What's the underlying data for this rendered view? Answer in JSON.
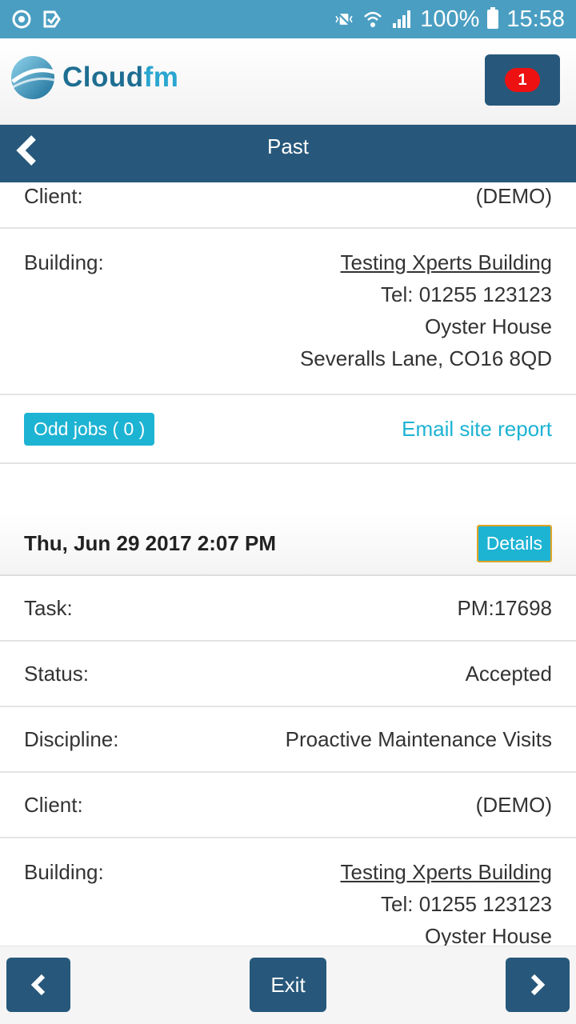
{
  "status_bar": {
    "battery_percent": "100%",
    "time": "15:58"
  },
  "header": {
    "logo_text_primary": "Cloud",
    "logo_text_secondary": "fm",
    "notification_count": "1"
  },
  "titlebar": {
    "title": "Past"
  },
  "job1": {
    "client_label": "Client:",
    "client_value": "(DEMO)",
    "building_label": "Building:",
    "building_name": "Testing Xperts Building",
    "building_tel": "Tel: 01255 123123",
    "building_line1": "Oyster House",
    "building_line2": "Severalls Lane, CO16 8QD",
    "odd_jobs_label": "Odd jobs ( 0 )",
    "email_report_label": "Email site report"
  },
  "job2": {
    "date": "Thu, Jun 29 2017 2:07 PM",
    "details_label": "Details",
    "task_label": "Task:",
    "task_value": "PM:17698",
    "status_label": "Status:",
    "status_value": "Accepted",
    "discipline_label": "Discipline:",
    "discipline_value": "Proactive Maintenance Visits",
    "client_label": "Client:",
    "client_value": "(DEMO)",
    "building_label": "Building:",
    "building_name": "Testing Xperts Building",
    "building_tel": "Tel: 01255 123123",
    "building_line1": "Oyster House"
  },
  "footer": {
    "exit_label": "Exit"
  },
  "colors": {
    "status_bar": "#4a9ec2",
    "primary": "#27587b",
    "accent": "#1db3d3",
    "badge": "#ee1111"
  }
}
